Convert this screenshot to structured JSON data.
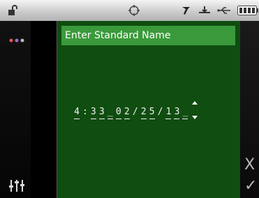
{
  "status_bar": {
    "icons": [
      "lock-open-icon",
      "target-icon",
      "pen-tool-icon",
      "tray-icon",
      "usb-icon",
      "battery-icon"
    ]
  },
  "left_rail": {
    "icons": [
      "color-dots-icon",
      "sliders-icon"
    ]
  },
  "main": {
    "title": "Enter Standard Name",
    "entry_chars": [
      "4",
      ":",
      "3",
      "3",
      "_",
      "0",
      "2",
      "/",
      "2",
      "5",
      "/",
      "1",
      "3",
      "_"
    ]
  },
  "right_rail": {
    "cancel_label": "X",
    "confirm_label": "✓"
  },
  "colors": {
    "panel_green": "#0f4d10",
    "title_green": "#3a9a3b",
    "dot_red": "#e05a5a",
    "dot_purple": "#a070d0",
    "dot_gray": "#bbbbbb"
  }
}
